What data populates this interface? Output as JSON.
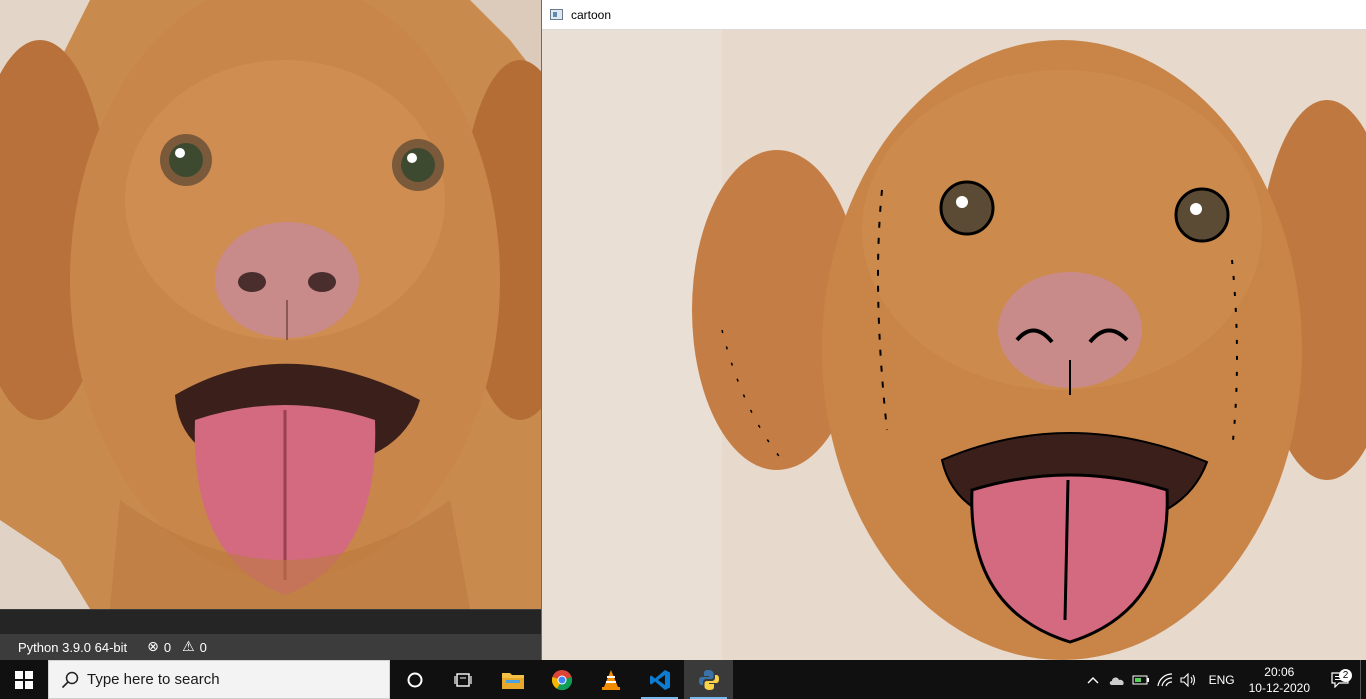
{
  "cartoon_window": {
    "title": "cartoon"
  },
  "vscode_status": {
    "python": "Python 3.9.0 64-bit",
    "errors": "0",
    "warnings": "0"
  },
  "taskbar": {
    "search_placeholder": "Type here to search",
    "apps": [
      "cortana-icon",
      "task-view-icon",
      "file-explorer-icon",
      "chrome-icon",
      "vlc-icon",
      "vscode-icon",
      "python-icon"
    ],
    "tray": {
      "language": "ENG",
      "time": "20:06",
      "date": "10-12-2020",
      "notification_count": "2"
    }
  },
  "colors": {
    "taskbar": "#101010",
    "fur": "#c27d41",
    "tongue": "#d36a80",
    "vscode_status": "#3c3c3c"
  }
}
